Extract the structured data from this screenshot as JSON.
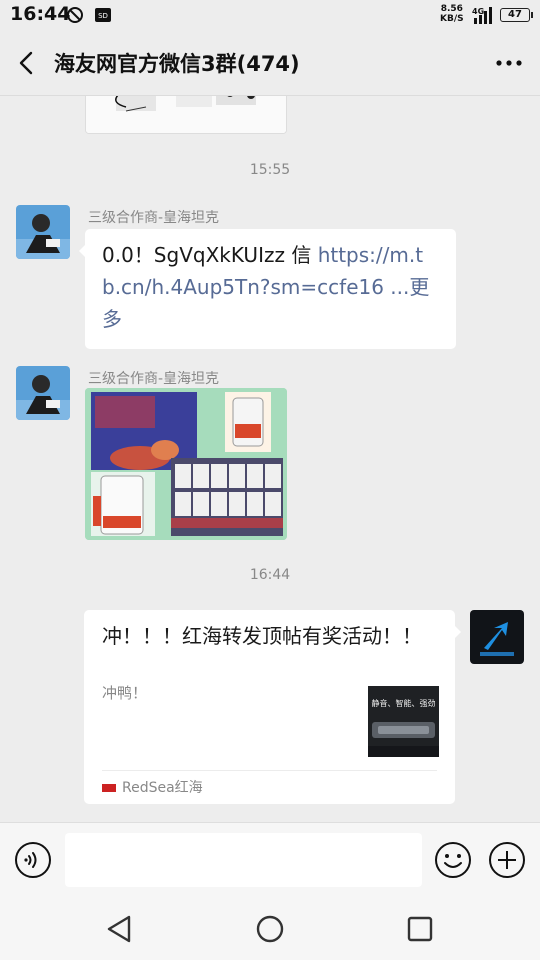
{
  "status_bar": {
    "time": "16:44",
    "net_speed_value": "8.56",
    "net_speed_unit": "KB/S",
    "network": "4G",
    "battery": "47"
  },
  "header": {
    "title": "海友网官方微信3群(474)"
  },
  "messages": {
    "time_1": "15:55",
    "msg1": {
      "sender": "三级合作商-皇海坦克",
      "text_plain": "0.0！SgVqXkKUIzz 信 ",
      "link": "https://m.tb.cn/h.4Aup5Tn?sm=ccfe16",
      "more": " ...更多"
    },
    "msg2": {
      "sender": "三级合作商-皇海坦克"
    },
    "time_2": "16:44",
    "msg3": {
      "card_title": "冲！！！红海转发顶帖有奖活动！！",
      "card_desc": "冲鸭！",
      "thumb_text": "静音、智能、强劲",
      "source": "RedSea红海"
    }
  },
  "input_bar": {
    "placeholder": ""
  },
  "colors": {
    "background": "#ededed",
    "link": "#576b95",
    "bubble": "#ffffff"
  }
}
